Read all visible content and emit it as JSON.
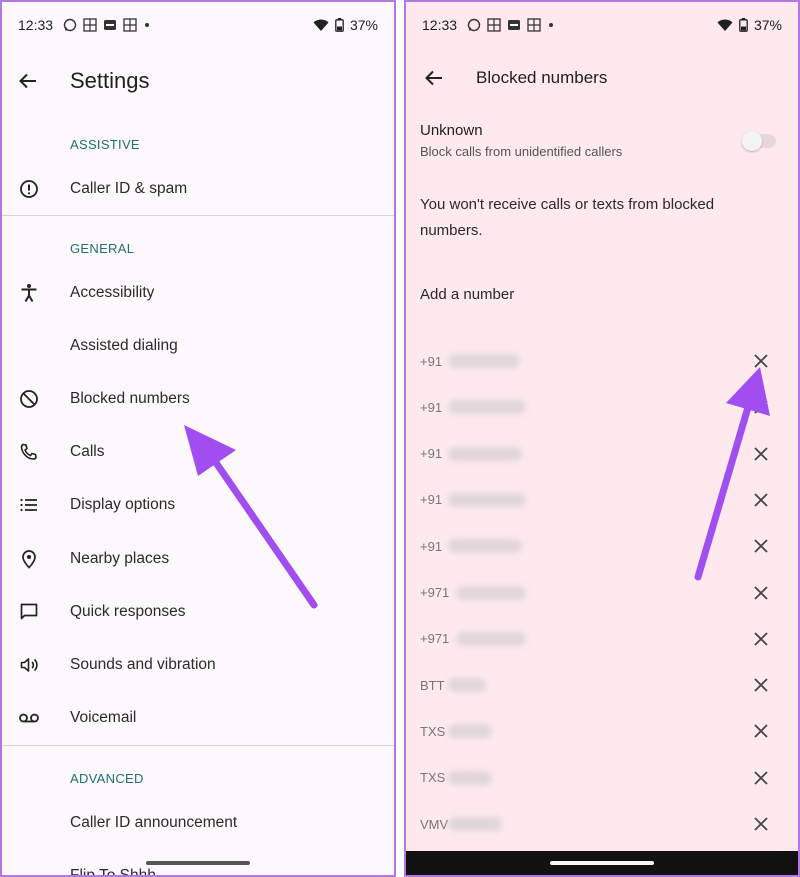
{
  "status": {
    "time": "12:33",
    "battery": "37%"
  },
  "left": {
    "title": "Settings",
    "sections": [
      {
        "header": "ASSISTIVE",
        "items": [
          "Caller ID & spam"
        ]
      },
      {
        "header": "GENERAL",
        "items": [
          "Accessibility",
          "Assisted dialing",
          "Blocked numbers",
          "Calls",
          "Display options",
          "Nearby places",
          "Quick responses",
          "Sounds and vibration",
          "Voicemail"
        ]
      },
      {
        "header": "ADVANCED",
        "items": [
          "Caller ID announcement",
          "Flip To Shhh"
        ]
      }
    ]
  },
  "right": {
    "title": "Blocked numbers",
    "unknown": {
      "title": "Unknown",
      "subtitle": "Block calls from unidentified callers",
      "enabled": false
    },
    "info": "You won't receive calls or texts from blocked numbers.",
    "add_number": "Add a number",
    "blocked": [
      "+91",
      "+91",
      "+91",
      "+91",
      "+91",
      "+971",
      "+971",
      "BTT",
      "TXS",
      "TXS",
      "VMV"
    ]
  },
  "colors": {
    "accent_arrow": "#a04ef0",
    "section_header": "#1f6f6f",
    "left_bg": "#fdf8fc",
    "right_bg": "#fde9ee"
  }
}
